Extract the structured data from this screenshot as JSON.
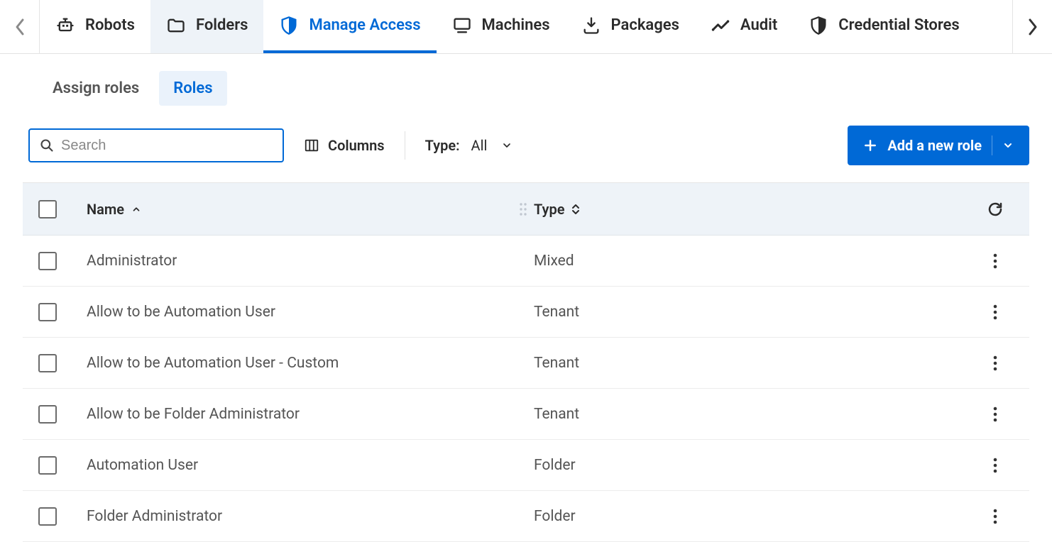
{
  "topTabs": [
    {
      "id": "robots",
      "label": "Robots",
      "icon": "robot"
    },
    {
      "id": "folders",
      "label": "Folders",
      "icon": "folder"
    },
    {
      "id": "manage-access",
      "label": "Manage Access",
      "icon": "shield-check",
      "active": true
    },
    {
      "id": "machines",
      "label": "Machines",
      "icon": "monitor"
    },
    {
      "id": "packages",
      "label": "Packages",
      "icon": "download"
    },
    {
      "id": "audit",
      "label": "Audit",
      "icon": "chart-line"
    },
    {
      "id": "credential-stores",
      "label": "Credential Stores",
      "icon": "shield"
    }
  ],
  "subTabs": {
    "assign": "Assign roles",
    "roles": "Roles"
  },
  "toolbar": {
    "search_placeholder": "Search",
    "columns_label": "Columns",
    "type_label": "Type:",
    "type_value": "All",
    "add_label": "Add a new role"
  },
  "table": {
    "headers": {
      "name": "Name",
      "type": "Type"
    },
    "rows": [
      {
        "name": "Administrator",
        "type": "Mixed"
      },
      {
        "name": "Allow to be Automation User",
        "type": "Tenant"
      },
      {
        "name": "Allow to be Automation User - Custom",
        "type": "Tenant"
      },
      {
        "name": "Allow to be Folder Administrator",
        "type": "Tenant"
      },
      {
        "name": "Automation User",
        "type": "Folder"
      },
      {
        "name": "Folder Administrator",
        "type": "Folder"
      }
    ]
  }
}
